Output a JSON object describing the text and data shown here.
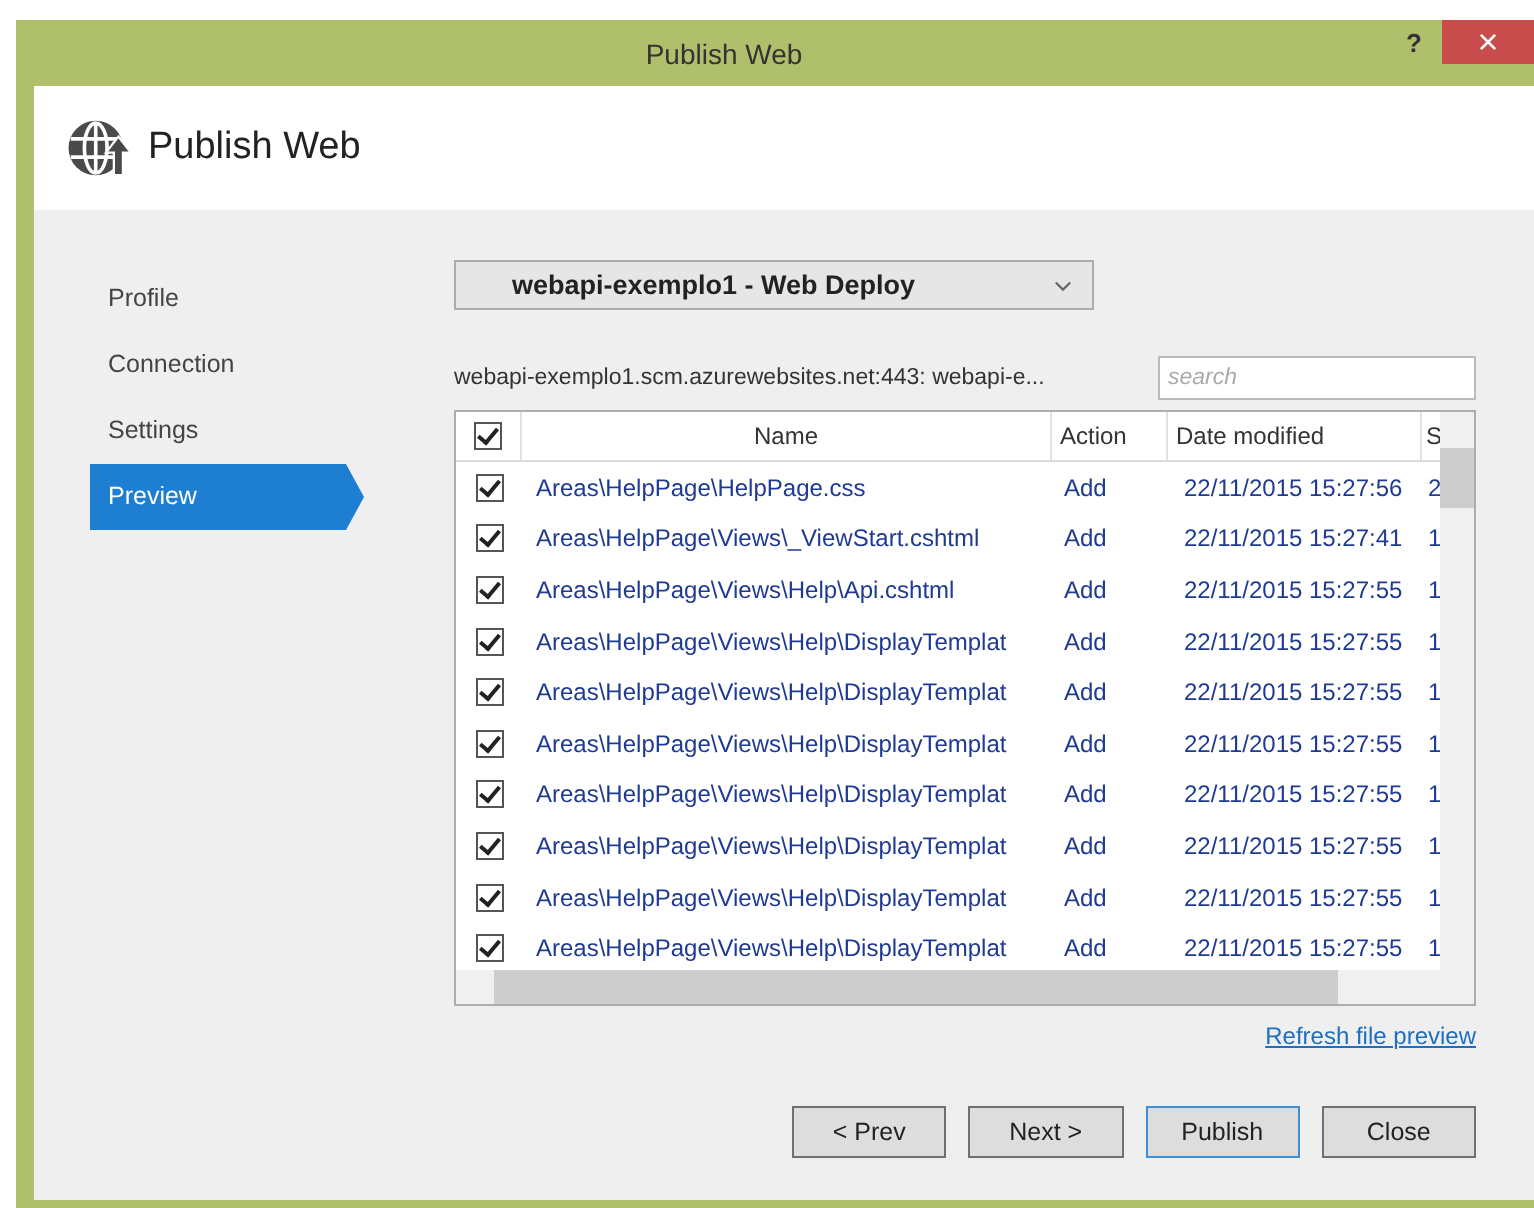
{
  "window": {
    "title": "Publish Web",
    "help": "?",
    "close": "×"
  },
  "header": {
    "title": "Publish Web"
  },
  "sidebar": {
    "items": [
      {
        "label": "Profile",
        "selected": false
      },
      {
        "label": "Connection",
        "selected": false
      },
      {
        "label": "Settings",
        "selected": false
      },
      {
        "label": "Preview",
        "selected": true
      }
    ]
  },
  "profile_dropdown": {
    "value": "webapi-exemplo1 - Web Deploy"
  },
  "connection_info": "webapi-exemplo1.scm.azurewebsites.net:443: webapi-e...",
  "search": {
    "placeholder": "search"
  },
  "table": {
    "all_checked": true,
    "columns": [
      "Name",
      "Action",
      "Date modified",
      "S"
    ],
    "rows": [
      {
        "checked": true,
        "name": "Areas\\HelpPage\\HelpPage.css",
        "action": "Add",
        "date": "22/11/2015 15:27:56",
        "column_5": "2"
      },
      {
        "checked": true,
        "name": "Areas\\HelpPage\\Views\\_ViewStart.cshtml",
        "action": "Add",
        "date": "22/11/2015 15:27:41",
        "column_5": "1"
      },
      {
        "checked": true,
        "name": "Areas\\HelpPage\\Views\\Help\\Api.cshtml",
        "action": "Add",
        "date": "22/11/2015 15:27:55",
        "column_5": "1"
      },
      {
        "checked": true,
        "name": "Areas\\HelpPage\\Views\\Help\\DisplayTemplat",
        "action": "Add",
        "date": "22/11/2015 15:27:55",
        "column_5": "1"
      },
      {
        "checked": true,
        "name": "Areas\\HelpPage\\Views\\Help\\DisplayTemplat",
        "action": "Add",
        "date": "22/11/2015 15:27:55",
        "column_5": "1"
      },
      {
        "checked": true,
        "name": "Areas\\HelpPage\\Views\\Help\\DisplayTemplat",
        "action": "Add",
        "date": "22/11/2015 15:27:55",
        "column_5": "1"
      },
      {
        "checked": true,
        "name": "Areas\\HelpPage\\Views\\Help\\DisplayTemplat",
        "action": "Add",
        "date": "22/11/2015 15:27:55",
        "column_5": "1"
      },
      {
        "checked": true,
        "name": "Areas\\HelpPage\\Views\\Help\\DisplayTemplat",
        "action": "Add",
        "date": "22/11/2015 15:27:55",
        "column_5": "1"
      },
      {
        "checked": true,
        "name": "Areas\\HelpPage\\Views\\Help\\DisplayTemplat",
        "action": "Add",
        "date": "22/11/2015 15:27:55",
        "column_5": "1"
      },
      {
        "checked": true,
        "name": "Areas\\HelpPage\\Views\\Help\\DisplayTemplat",
        "action": "Add",
        "date": "22/11/2015 15:27:55",
        "column_5": "1"
      }
    ]
  },
  "refresh_link": "Refresh file preview",
  "buttons": [
    {
      "label": "< Prev",
      "default": false
    },
    {
      "label": "Next >",
      "default": false
    },
    {
      "label": "Publish",
      "default": true
    },
    {
      "label": "Close",
      "default": false
    }
  ]
}
